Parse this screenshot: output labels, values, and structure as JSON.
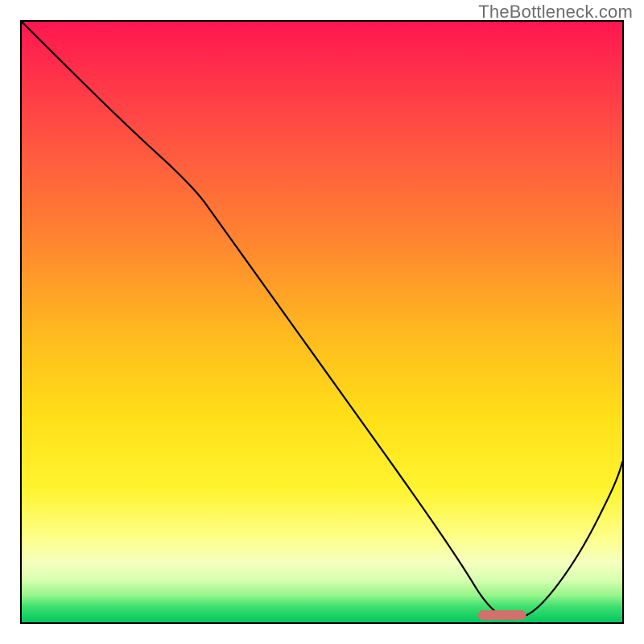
{
  "watermark": "TheBottleneck.com",
  "chart_data": {
    "type": "line",
    "title": "",
    "xlabel": "",
    "ylabel": "",
    "xlim": [
      0,
      100
    ],
    "ylim": [
      0,
      100
    ],
    "grid": false,
    "legend": false,
    "gradient": {
      "direction": "vertical",
      "top": "bad",
      "bottom": "good",
      "stops": [
        {
          "pos": 0,
          "color": "#ff1650",
          "meaning": "severe-bottleneck"
        },
        {
          "pos": 50,
          "color": "#ffc31a",
          "meaning": "moderate"
        },
        {
          "pos": 88,
          "color": "#fbff90",
          "meaning": "low"
        },
        {
          "pos": 100,
          "color": "#05c75e",
          "meaning": "optimal"
        }
      ]
    },
    "series": [
      {
        "name": "bottleneck-curve",
        "x": [
          0,
          10,
          20,
          28,
          40,
          52,
          64,
          72,
          77,
          82,
          88,
          94,
          100
        ],
        "values": [
          100,
          90,
          80,
          74,
          58,
          41,
          24,
          10,
          3,
          1,
          6,
          15,
          27
        ]
      }
    ],
    "annotations": [
      {
        "name": "optimal-marker",
        "shape": "rounded-bar",
        "x_center": 79,
        "y": 1,
        "color": "#d36f6c"
      }
    ]
  }
}
